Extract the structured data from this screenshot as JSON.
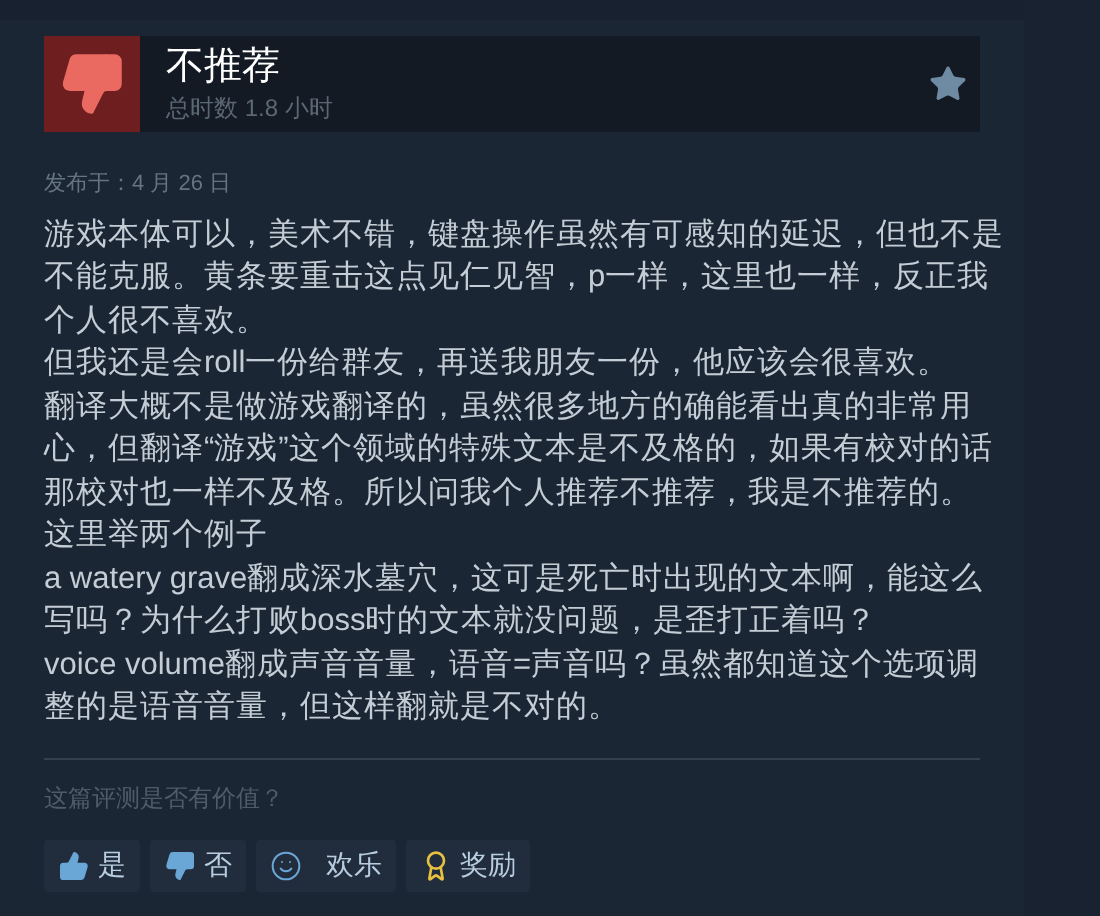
{
  "review": {
    "verdict": "不推荐",
    "recommended": false,
    "playtime": "总时数 1.8 小时",
    "posted": "发布于：4 月 26 日",
    "paragraphs": [
      "游戏本体可以，美术不错，键盘操作虽然有可感知的延迟，但也不是不能克服。黄条要重击这点见仁见智，p一样，这里也一样，反正我个人很不喜欢。",
      "但我还是会roll一份给群友，再送我朋友一份，他应该会很喜欢。",
      "翻译大概不是做游戏翻译的，虽然很多地方的确能看出真的非常用心，但翻译“游戏”这个领域的特殊文本是不及格的，如果有校对的话那校对也一样不及格。所以问我个人推荐不推荐，我是不推荐的。",
      "这里举两个例子",
      "a watery grave翻成深水墓穴，这可是死亡时出现的文本啊，能这么写吗？为什么打败boss时的文本就没问题，是歪打正着吗？",
      "voice volume翻成声音音量，语音=声音吗？虽然都知道这个选项调整的是语音音量，但这样翻就是不对的。"
    ]
  },
  "feedback": {
    "question": "这篇评测是否有价值？",
    "buttons": [
      {
        "kind": "yes",
        "label": "是"
      },
      {
        "kind": "no",
        "label": "否"
      },
      {
        "kind": "funny",
        "label": "欢乐"
      },
      {
        "kind": "award",
        "label": "奖励"
      }
    ]
  }
}
